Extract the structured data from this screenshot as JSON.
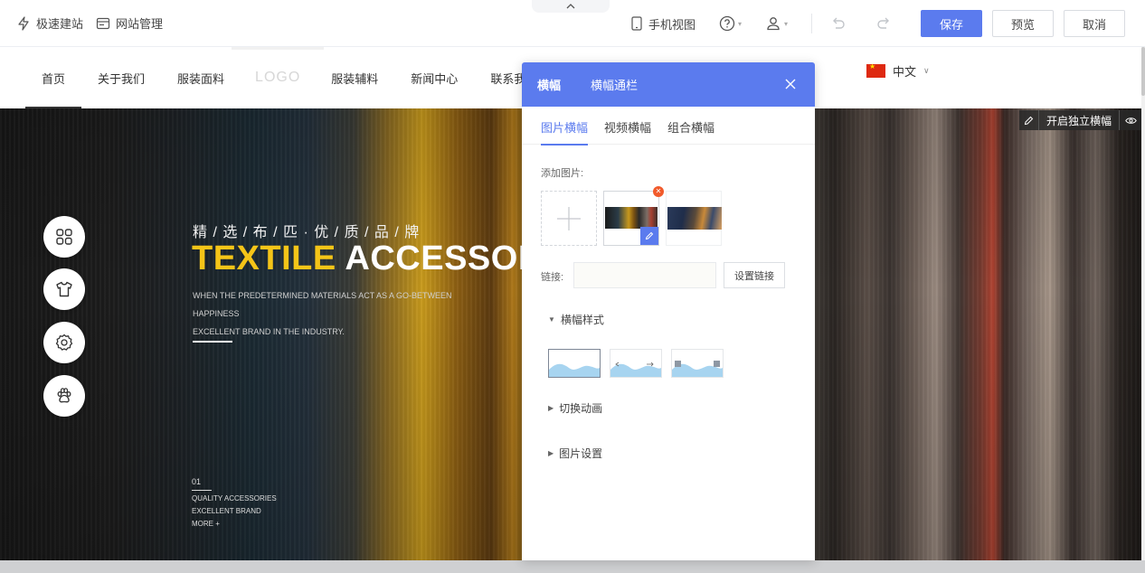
{
  "toolbar": {
    "quick_build": "极速建站",
    "site_manage": "网站管理",
    "mobile_view": "手机视图",
    "save": "保存",
    "preview": "预览",
    "cancel": "取消"
  },
  "nav": {
    "items": [
      "首页",
      "关于我们",
      "服装面料",
      "LOGO",
      "服装辅料",
      "新闻中心",
      "联系我"
    ],
    "language": "中文"
  },
  "banner": {
    "tool_label": "开启独立横幅",
    "subtitle": "精 / 选 / 布 / 匹 · 优 / 质 / 品 / 牌",
    "title_yellow": "TEXTILE",
    "title_white": "ACCESSOR",
    "desc_line1": "WHEN THE PREDETERMINED MATERIALS ACT AS A GO-BETWEEN HAPPINESS",
    "desc_line2": "EXCELLENT BRAND IN THE INDUSTRY.",
    "index": "01",
    "list": [
      "QUALITY ACCESSORIES",
      "EXCELLENT BRAND",
      "MORE +"
    ]
  },
  "panel": {
    "tabs": [
      "横幅",
      "横幅通栏"
    ],
    "sub_tabs": [
      "图片横幅",
      "视频横幅",
      "组合横幅"
    ],
    "add_image_label": "添加图片:",
    "link_label": "链接:",
    "link_value": "",
    "set_link_button": "设置链接",
    "sections": [
      "横幅样式",
      "切换动画",
      "图片设置"
    ]
  },
  "colors": {
    "accent": "#5b7bee",
    "title_yellow": "#f5c518",
    "remove_badge": "#f15a2b"
  }
}
